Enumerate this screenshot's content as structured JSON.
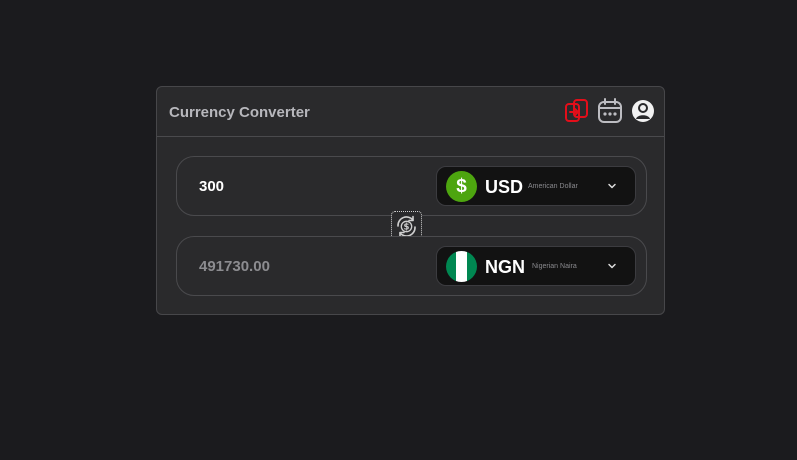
{
  "app": {
    "title": "Currency Converter"
  },
  "header": {
    "icons": [
      "convert-icon",
      "calendar-icon",
      "user-icon"
    ],
    "accent_color": "#e30e1a"
  },
  "from": {
    "amount": "300",
    "currency": {
      "code": "USD",
      "name": "American Dollar",
      "flag_symbol": "$",
      "flag_color": "#4da50f"
    }
  },
  "to": {
    "amount": "491730.00",
    "currency": {
      "code": "NGN",
      "name": "Nigerian Naira",
      "flag_colors": [
        "#008751",
        "#ffffff",
        "#008751"
      ]
    }
  },
  "swap": {
    "icon": "swap-currency-icon"
  }
}
